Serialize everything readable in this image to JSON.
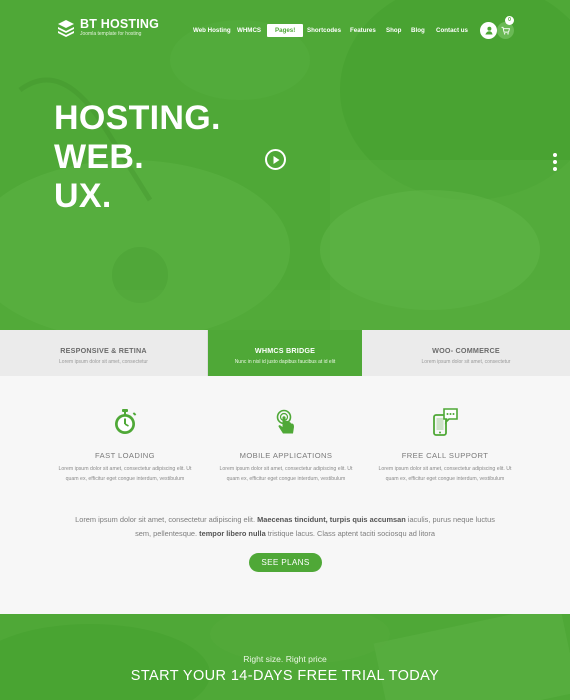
{
  "brand": {
    "name": "BT HOSTING",
    "tagline": "Joomla template for hosting"
  },
  "nav": {
    "items": [
      {
        "label": "Web Hosting"
      },
      {
        "label": "WHMCS"
      },
      {
        "label": "Pages!",
        "active": true
      },
      {
        "label": "Shortcodes"
      },
      {
        "label": "Features"
      },
      {
        "label": "Shop"
      },
      {
        "label": "Blog"
      },
      {
        "label": "Contact us"
      }
    ],
    "cart_count": "0"
  },
  "hero": {
    "lines": [
      "HOSTING.",
      "WEB.",
      "UX."
    ]
  },
  "tabs": [
    {
      "title": "RESPONSIVE & RETINA",
      "text": "Lorem ipsum dolor sit amet, consectetur"
    },
    {
      "title": "WHMCS BRIDGE",
      "text": "Nunc in nisl id justo dapibus faucibus at id elit",
      "active": true
    },
    {
      "title": "WOO- COMMERCE",
      "text": "Lorem ipsum dolor sit amet, consectetur"
    }
  ],
  "features": [
    {
      "icon": "stopwatch-icon",
      "title": "FAST LOADING",
      "text": "Lorem ipsum dolor sit amet, consectetur adipiscing elit. Ut quam ex, efficitur eget congue interdum, vestibulum"
    },
    {
      "icon": "touch-hand-icon",
      "title": "MOBILE APPLICATIONS",
      "text": "Lorem ipsum dolor sit amet, consectetur adipiscing elit. Ut quam ex, efficitur eget congue interdum, vestibulum"
    },
    {
      "icon": "phone-chat-icon",
      "title": "FREE CALL SUPPORT",
      "text": "Lorem ipsum dolor sit amet, consectetur adipiscing elit. Ut quam ex, efficitur eget congue interdum, vestibulum"
    }
  ],
  "intro": {
    "p1_before": "Lorem ipsum dolor sit amet, consectetur adipiscing elit. ",
    "p1_bold": "Maecenas tincidunt, turpis quis accumsan",
    "p1_after": " iaculis, purus neque luctus",
    "p2_before": "sem, pellentesque. ",
    "p2_bold": "tempor libero nulla",
    "p2_after": " tristique lacus. Class aptent taciti sociosqu ad litora"
  },
  "cta": {
    "button": "SEE PLANS",
    "subtitle": "Right size. Right price",
    "title": "START YOUR 14-DAYS FREE TRIAL TODAY"
  },
  "colors": {
    "brand_green": "#4fa837",
    "tab_bg": "#ebebeb",
    "body_bg": "#f7f7f7"
  }
}
